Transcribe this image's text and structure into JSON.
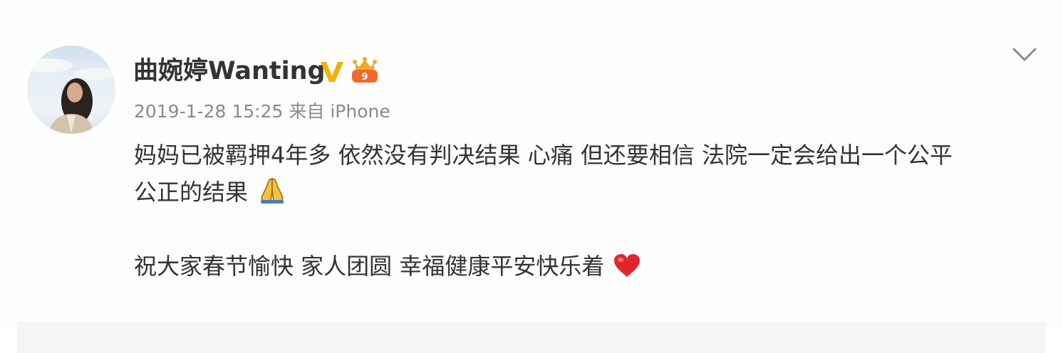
{
  "post": {
    "author": {
      "name": "曲婉婷Wanting",
      "verified_badge": "verified-v-icon",
      "vip_badge": "vip-crown-icon"
    },
    "meta": {
      "timestamp": "2019-1-28 15:25",
      "source": "来自 iPhone"
    },
    "content": {
      "line1": "妈妈已被羁押4年多 依然没有判决结果 心痛 但还要相信 法院一定会给出一个公平",
      "line2": "公正的结果",
      "line2_emoji": "folded-hands-emoji",
      "line3": "祝大家春节愉快 家人团圆 幸福健康平安快乐着",
      "line3_emoji": "red-heart-emoji"
    },
    "menu_icon": "chevron-down-icon"
  },
  "colors": {
    "text": "#333333",
    "meta_text": "#8a8a8a",
    "verified_gold": "#f4b000",
    "heart_red": "#e0262c",
    "chevron": "#8a8a8a"
  }
}
